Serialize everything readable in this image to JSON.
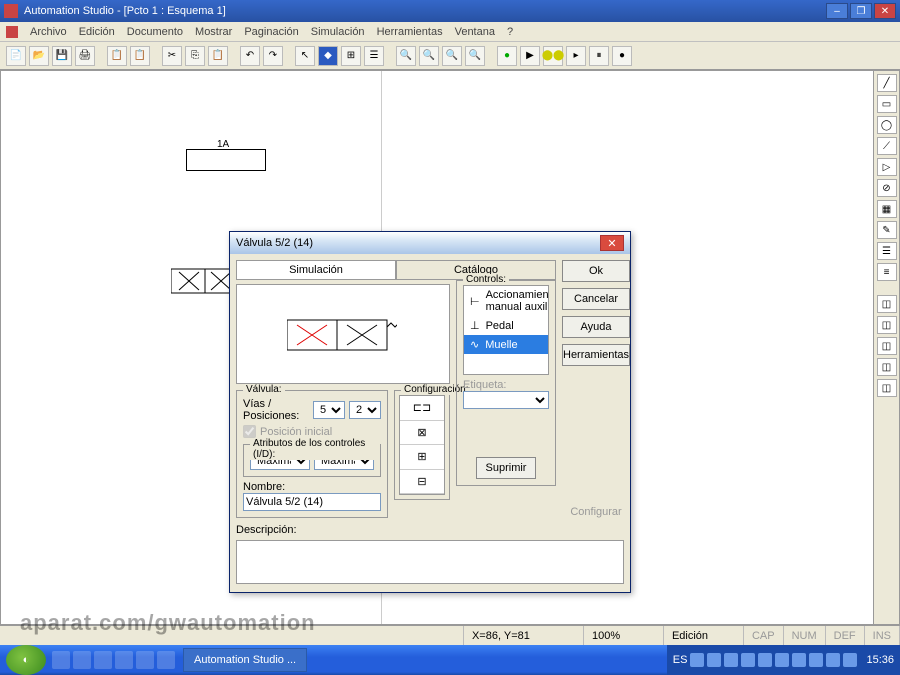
{
  "title": "Automation Studio - [Pcto 1 : Esquema 1]",
  "menu": [
    "Archivo",
    "Edición",
    "Documento",
    "Mostrar",
    "Paginación",
    "Simulación",
    "Herramientas",
    "Ventana",
    "?"
  ],
  "status": {
    "coords": "X=86, Y=81",
    "zoom": "100%",
    "mode": "Edición",
    "caps": "CAP",
    "num": "NUM",
    "def": "DEF",
    "ins": "INS"
  },
  "dialog": {
    "title": "Válvula 5/2 (14)",
    "tab1": "Simulación",
    "tab2": "Catálogo",
    "ok": "Ok",
    "cancel": "Cancelar",
    "help": "Ayuda",
    "tools": "Herramientas",
    "valvula": "Válvula:",
    "vias_pos": "Vías / Posiciones:",
    "vias": "5",
    "pos": "2",
    "pos_ini": "Posición inicial",
    "attr": "Atributos de los controles (I/D):",
    "max1": "Máxima",
    "max2": "Máxima",
    "nombre_lbl": "Nombre:",
    "nombre": "Válvula 5/2 (14)",
    "config": "Configuración:",
    "controls": "Controls:",
    "c1": "Accionamiento manual auxilia",
    "c2": "Pedal",
    "c3": "Muelle",
    "etiqueta": "Etiqueta:",
    "suprimir": "Suprimir",
    "configurar": "Configurar",
    "desc": "Descripción:"
  },
  "canvas": {
    "tag": "1A"
  },
  "taskbar": {
    "task": "Automation Studio ...",
    "lang": "ES",
    "time": "15:36"
  },
  "watermark": "aparat.com/gwautomation"
}
